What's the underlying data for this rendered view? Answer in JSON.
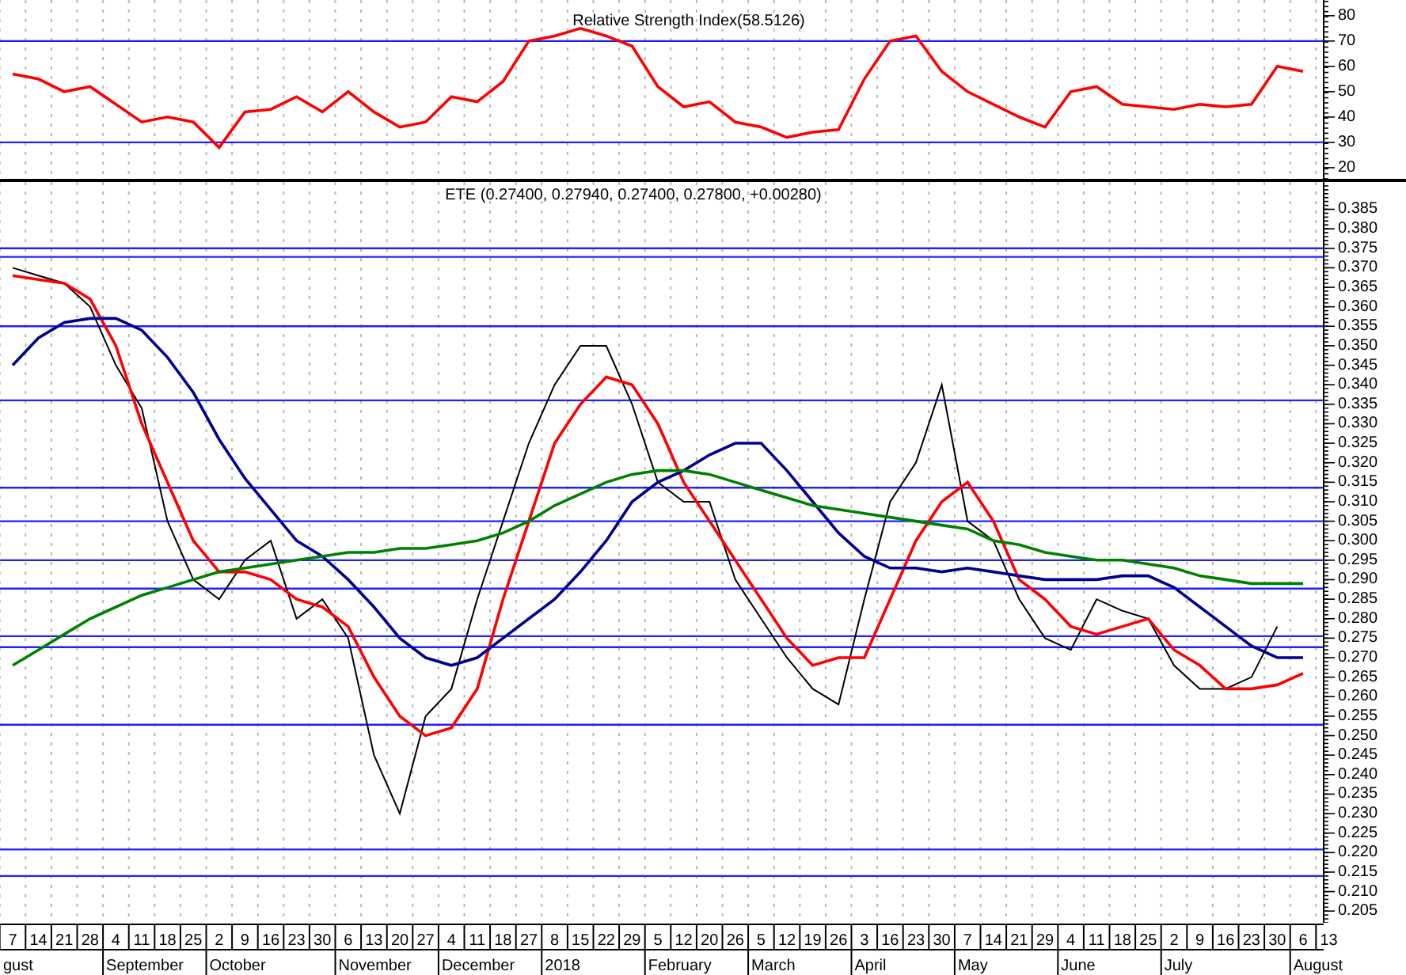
{
  "rsi_panel": {
    "chart_data": {
      "type": "line",
      "title": "Relative Strength Index(58.5126)",
      "ylim": [
        15.6,
        86.2
      ],
      "yticks": [
        20,
        30,
        40,
        50,
        60,
        70,
        80
      ],
      "series": [
        {
          "color": "#ff0000",
          "values": [
            57,
            55,
            50,
            52,
            45,
            38,
            40,
            38,
            28,
            42,
            43,
            48,
            42,
            50,
            42,
            36,
            38,
            48,
            46,
            54,
            70,
            72,
            75,
            72,
            68,
            52,
            44,
            46,
            38,
            36,
            32,
            34,
            35,
            55,
            70,
            72,
            58,
            50,
            45,
            40,
            36,
            50,
            52,
            45,
            44,
            43,
            45,
            44,
            45,
            60,
            58,
            null
          ]
        }
      ],
      "grid": true,
      "ref_lines": [
        {
          "axis": "y",
          "value": 70
        },
        {
          "axis": "y",
          "value": 30
        }
      ]
    }
  },
  "price_panel": {
    "chart_data": {
      "type": "line",
      "title": "ETE (0.27400, 0.27940, 0.27400, 0.27800, +0.00280)",
      "categories": [
        "7",
        "14",
        "21",
        "28",
        "4",
        "11",
        "18",
        "25",
        "2",
        "9",
        "16",
        "23",
        "30",
        "6",
        "13",
        "20",
        "27",
        "4",
        "11",
        "18",
        "27",
        "8",
        "15",
        "22",
        "29",
        "5",
        "12",
        "20",
        "26",
        "5",
        "12",
        "19",
        "26",
        "3",
        "16",
        "23",
        "30",
        "7",
        "14",
        "21",
        "29",
        "4",
        "11",
        "18",
        "25",
        "2",
        "9",
        "16",
        "23",
        "30",
        "6",
        "13"
      ],
      "ylim": [
        0.202,
        0.392
      ],
      "yticks": [
        {
          "value": 0.385,
          "label": "0.385"
        },
        {
          "value": 0.38,
          "label": "0.380"
        },
        {
          "value": 0.375,
          "label": "0.375"
        },
        {
          "value": 0.37,
          "label": "0.370"
        },
        {
          "value": 0.365,
          "label": "0.365"
        },
        {
          "value": 0.36,
          "label": "0.360"
        },
        {
          "value": 0.355,
          "label": "0.355"
        },
        {
          "value": 0.35,
          "label": "0.350"
        },
        {
          "value": 0.345,
          "label": "0.345"
        },
        {
          "value": 0.34,
          "label": "0.340"
        },
        {
          "value": 0.335,
          "label": "0.335"
        },
        {
          "value": 0.33,
          "label": "0.330"
        },
        {
          "value": 0.325,
          "label": "0.325"
        },
        {
          "value": 0.32,
          "label": "0.320"
        },
        {
          "value": 0.315,
          "label": "0.315"
        },
        {
          "value": 0.31,
          "label": "0.310"
        },
        {
          "value": 0.305,
          "label": "0.305"
        },
        {
          "value": 0.3,
          "label": "0.300"
        },
        {
          "value": 0.295,
          "label": "0.295"
        },
        {
          "value": 0.29,
          "label": "0.290"
        },
        {
          "value": 0.285,
          "label": "0.285"
        },
        {
          "value": 0.28,
          "label": "0.280"
        },
        {
          "value": 0.275,
          "label": "0.275"
        },
        {
          "value": 0.27,
          "label": "0.270"
        },
        {
          "value": 0.265,
          "label": "0.265"
        },
        {
          "value": 0.26,
          "label": "0.260"
        },
        {
          "value": 0.255,
          "label": "0.255"
        },
        {
          "value": 0.25,
          "label": "0.250"
        },
        {
          "value": 0.245,
          "label": "0.245"
        },
        {
          "value": 0.24,
          "label": "0.240"
        },
        {
          "value": 0.235,
          "label": "0.235"
        },
        {
          "value": 0.23,
          "label": "0.230"
        },
        {
          "value": 0.225,
          "label": "0.225"
        },
        {
          "value": 0.22,
          "label": "0.220"
        },
        {
          "value": 0.215,
          "label": "0.215"
        },
        {
          "value": 0.21,
          "label": "0.210"
        },
        {
          "value": 0.205,
          "label": "0.205"
        }
      ],
      "series": [
        {
          "color": "#000000",
          "values": [
            0.37,
            0.368,
            0.366,
            0.36,
            0.345,
            0.334,
            0.305,
            0.29,
            0.285,
            0.295,
            0.3,
            0.28,
            0.285,
            0.275,
            0.245,
            0.23,
            0.255,
            0.262,
            0.285,
            0.305,
            0.325,
            0.34,
            0.35,
            0.35,
            0.335,
            0.315,
            0.31,
            0.31,
            0.29,
            0.28,
            0.27,
            0.262,
            0.258,
            0.285,
            0.31,
            0.32,
            0.34,
            0.305,
            0.3,
            0.285,
            0.275,
            0.272,
            0.285,
            0.282,
            0.28,
            0.268,
            0.262,
            0.262,
            0.265,
            0.278,
            null,
            null
          ]
        },
        {
          "color": "#ff0000",
          "values": [
            0.368,
            0.367,
            0.366,
            0.362,
            0.35,
            0.33,
            0.315,
            0.3,
            0.292,
            0.292,
            0.29,
            0.285,
            0.283,
            0.278,
            0.265,
            0.255,
            0.25,
            0.252,
            0.262,
            0.285,
            0.305,
            0.325,
            0.335,
            0.342,
            0.34,
            0.33,
            0.315,
            0.305,
            0.295,
            0.285,
            0.275,
            0.268,
            0.27,
            0.27,
            0.285,
            0.3,
            0.31,
            0.315,
            0.305,
            0.29,
            0.285,
            0.278,
            0.276,
            0.278,
            0.28,
            0.272,
            0.268,
            0.262,
            0.262,
            0.263,
            0.266,
            null
          ]
        },
        {
          "color": "#000090",
          "values": [
            0.345,
            0.352,
            0.356,
            0.357,
            0.357,
            0.354,
            0.347,
            0.338,
            0.326,
            0.316,
            0.308,
            0.3,
            0.296,
            0.29,
            0.283,
            0.275,
            0.27,
            0.268,
            0.27,
            0.275,
            0.28,
            0.285,
            0.292,
            0.3,
            0.31,
            0.315,
            0.318,
            0.322,
            0.325,
            0.325,
            0.318,
            0.31,
            0.302,
            0.296,
            0.293,
            0.293,
            0.292,
            0.293,
            0.292,
            0.291,
            0.29,
            0.29,
            0.29,
            0.291,
            0.291,
            0.288,
            0.283,
            0.278,
            0.273,
            0.27,
            0.27,
            null
          ]
        },
        {
          "color": "#008000",
          "values": [
            0.268,
            0.272,
            0.276,
            0.28,
            0.283,
            0.286,
            0.288,
            0.29,
            0.292,
            0.293,
            0.294,
            0.295,
            0.296,
            0.297,
            0.297,
            0.298,
            0.298,
            0.299,
            0.3,
            0.302,
            0.305,
            0.309,
            0.312,
            0.315,
            0.317,
            0.318,
            0.318,
            0.317,
            0.315,
            0.313,
            0.311,
            0.309,
            0.308,
            0.307,
            0.306,
            0.305,
            0.304,
            0.303,
            0.3,
            0.299,
            0.297,
            0.296,
            0.295,
            0.295,
            0.294,
            0.293,
            0.291,
            0.29,
            0.289,
            0.289,
            0.289,
            null
          ]
        }
      ],
      "grid": true,
      "ref_lines": [
        {
          "axis": "y",
          "value": 0.375
        },
        {
          "axis": "y",
          "value": 0.3728
        },
        {
          "axis": "y",
          "value": 0.355
        },
        {
          "axis": "y",
          "value": 0.336
        },
        {
          "axis": "y",
          "value": 0.3136
        },
        {
          "axis": "y",
          "value": 0.305
        },
        {
          "axis": "y",
          "value": 0.295
        },
        {
          "axis": "y",
          "value": 0.2877
        },
        {
          "axis": "y",
          "value": 0.2755
        },
        {
          "axis": "y",
          "value": 0.2727
        },
        {
          "axis": "y",
          "value": 0.2528
        },
        {
          "axis": "y",
          "value": 0.2208
        },
        {
          "axis": "y",
          "value": 0.214
        }
      ]
    }
  },
  "date_axis": {
    "months": [
      "gust",
      "September",
      "October",
      "November",
      "December",
      "2018",
      "February",
      "March",
      "April",
      "May",
      "June",
      "July",
      "August"
    ]
  }
}
